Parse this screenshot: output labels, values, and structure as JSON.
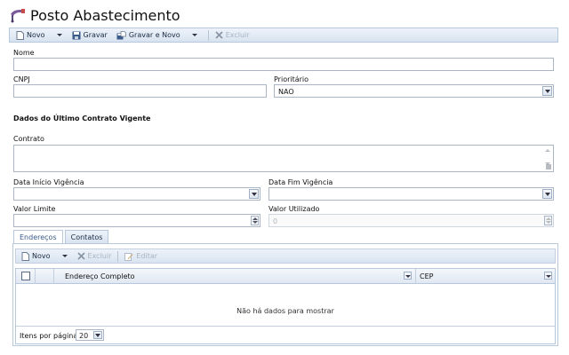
{
  "page": {
    "title": "Posto Abastecimento",
    "icon": "fuel-pump-icon"
  },
  "toolbar": {
    "novo": "Novo",
    "gravar": "Gravar",
    "gravar_e_novo": "Gravar e Novo",
    "excluir": "Excluir"
  },
  "form": {
    "nome_label": "Nome",
    "nome_value": "",
    "cnpj_label": "CNPJ",
    "cnpj_value": "",
    "prioritario_label": "Prioritário",
    "prioritario_value": "NAO",
    "section_title": "Dados do Último Contrato Vigente",
    "contrato_label": "Contrato",
    "contrato_value": "",
    "data_inicio_label": "Data Início Vigência",
    "data_inicio_value": "",
    "data_fim_label": "Data Fim Vigência",
    "data_fim_value": "",
    "valor_limite_label": "Valor Limite",
    "valor_limite_value": "",
    "valor_utilizado_label": "Valor Utilizado",
    "valor_utilizado_value": "0"
  },
  "tabs": [
    {
      "label": "Endereços",
      "active": true
    },
    {
      "label": "Contatos",
      "active": false
    }
  ],
  "inner_toolbar": {
    "novo": "Novo",
    "excluir": "Excluir",
    "editar": "Editar"
  },
  "grid": {
    "columns": [
      "Endereço Completo",
      "CEP"
    ],
    "empty_message": "Não há dados para mostrar",
    "pager_label": "Itens por página:",
    "page_size": "20"
  },
  "colors": {
    "accent": "#3a5a8a",
    "border": "#b8c8dc",
    "toolbar_bg": "#dde6f0"
  }
}
